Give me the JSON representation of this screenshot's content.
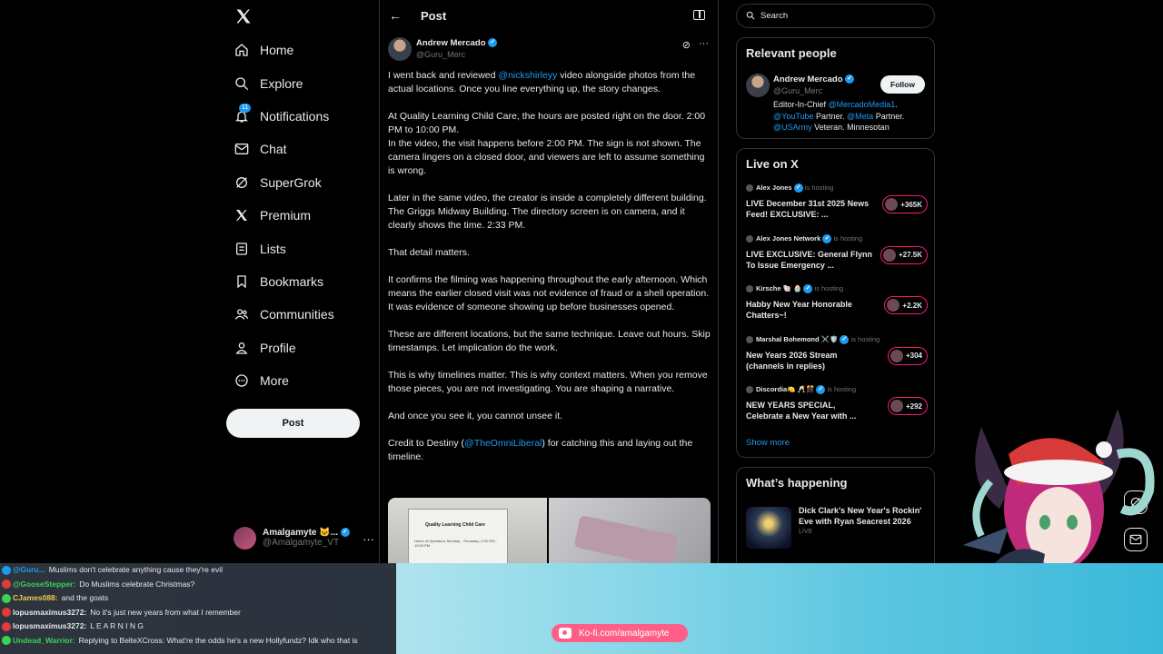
{
  "sidebar": {
    "logo": "X",
    "nav": [
      {
        "label": "Home",
        "icon": "home-icon"
      },
      {
        "label": "Explore",
        "icon": "search-icon"
      },
      {
        "label": "Notifications",
        "icon": "bell-icon",
        "badge": "11"
      },
      {
        "label": "Chat",
        "icon": "mail-icon"
      },
      {
        "label": "SuperGrok",
        "icon": "grok-icon"
      },
      {
        "label": "Premium",
        "icon": "x-icon"
      },
      {
        "label": "Lists",
        "icon": "list-icon"
      },
      {
        "label": "Bookmarks",
        "icon": "bookmark-icon"
      },
      {
        "label": "Communities",
        "icon": "people-icon"
      },
      {
        "label": "Profile",
        "icon": "person-icon"
      },
      {
        "label": "More",
        "icon": "more-circle-icon"
      }
    ],
    "post_button": "Post",
    "account": {
      "name": "Amalgamyte 🐱...",
      "handle": "@Amalgamyte_VT"
    }
  },
  "main": {
    "title": "Post",
    "author": {
      "name": "Andrew Mercado",
      "handle": "@Guru_Merc"
    },
    "paragraphs": [
      [
        "I went back and reviewed ",
        {
          "mention": "@nickshirleyy"
        },
        " video alongside photos from the actual locations. Once you line everything up, the story changes."
      ],
      [
        "At Quality Learning Child Care, the hours are posted right on the door. 2:00 PM to 10:00 PM.\nIn the video, the visit happens before 2:00 PM. The sign is not shown. The camera lingers on a closed door, and viewers are left to assume something is wrong."
      ],
      [
        "Later in the same video, the creator is inside a completely different building. The Griggs Midway Building. The directory screen is on camera, and it clearly shows the time. 2:33 PM."
      ],
      [
        "That detail matters."
      ],
      [
        "It confirms the filming was happening throughout the early afternoon. Which means the earlier closed visit was not evidence of fraud or a shell operation. It was evidence of someone showing up before businesses opened."
      ],
      [
        "These are different locations, but the same technique. Leave out hours. Skip timestamps. Let implication do the work."
      ],
      [
        "This is why timelines matter. This is why context matters. When you remove those pieces, you are not investigating. You are shaping a narrative."
      ],
      [
        "And once you see it, you cannot unsee it."
      ],
      [
        "Credit to Destiny (",
        {
          "mention": "@TheOmniLiberal"
        },
        ") for catching this and laying out the timeline."
      ]
    ],
    "media": {
      "doc_title": "Quality Learning Child Care",
      "doc_line": "Hours of Operation:  Monday - Thursday | 2:00 PM - 10:00 PM"
    }
  },
  "right": {
    "search_placeholder": "Search",
    "relevant": {
      "title": "Relevant people",
      "name": "Andrew Mercado",
      "handle": "@Guru_Merc",
      "follow": "Follow",
      "bio": [
        {
          "t": "Editor-In-Chief "
        },
        {
          "m": "@MercadoMedia1"
        },
        {
          "t": ". "
        },
        {
          "m": "@YouTube"
        },
        {
          "t": " Partner. "
        },
        {
          "m": "@Meta"
        },
        {
          "t": " Partner. "
        },
        {
          "m": "@USArmy"
        },
        {
          "t": " Veteran. Minnesotan"
        }
      ]
    },
    "live": {
      "title": "Live on X",
      "hosting_label": "is hosting",
      "items": [
        {
          "host": "Alex Jones",
          "title": "LIVE December 31st 2025 News Feed! EXCLUSIVE: ...",
          "count": "+365K"
        },
        {
          "host": "Alex Jones Network",
          "title": "LIVE EXCLUSIVE: General Flynn To Issue Emergency ...",
          "count": "+27.5K"
        },
        {
          "host": "Kirsche 🐚 🧁",
          "title": "Habby New Year Honorable Chatters~!",
          "count": "+2.2K"
        },
        {
          "host": "Marshal Bohemond ⚔️🛡️",
          "title": "New Years 2026 Stream (channels in replies)",
          "count": "+304"
        },
        {
          "host": "Discordia🍋 🥂🎊",
          "title": "NEW YEARS SPECIAL, Celebrate a New Year with ...",
          "count": "+292"
        }
      ],
      "show_more": "Show more"
    },
    "whats_happening": {
      "title": "What’s happening",
      "item_title": "Dick Clark's New Year's Rockin' Eve with Ryan Seacrest 2026",
      "item_sub": "LIVE"
    }
  },
  "stream": {
    "chat": [
      {
        "user": "@Guru...",
        "text": "Muslims don't celebrate anything cause they're evil",
        "color": "#1d9bf0"
      },
      {
        "user": "@GooseStepper:",
        "text": "Do Muslims celebrate Christmas?",
        "color": "#39d353"
      },
      {
        "user": "CJames088:",
        "text": "and the goats",
        "color": "#f2c94c"
      },
      {
        "user": "lopusmaximus3272:",
        "text": "No it's just new years from what I remember",
        "color": "#e7e9ea"
      },
      {
        "user": "lopusmaximus3272:",
        "text": "L E A R N I N G",
        "color": "#e7e9ea"
      },
      {
        "user": "Undead_Warrior:",
        "text": "Replying to BelteXCross: What're the odds he's a new Hollyfundz? Idk who that is",
        "color": "#39d353"
      }
    ],
    "kofi": "Ko-fi.com/amalgamyte"
  }
}
